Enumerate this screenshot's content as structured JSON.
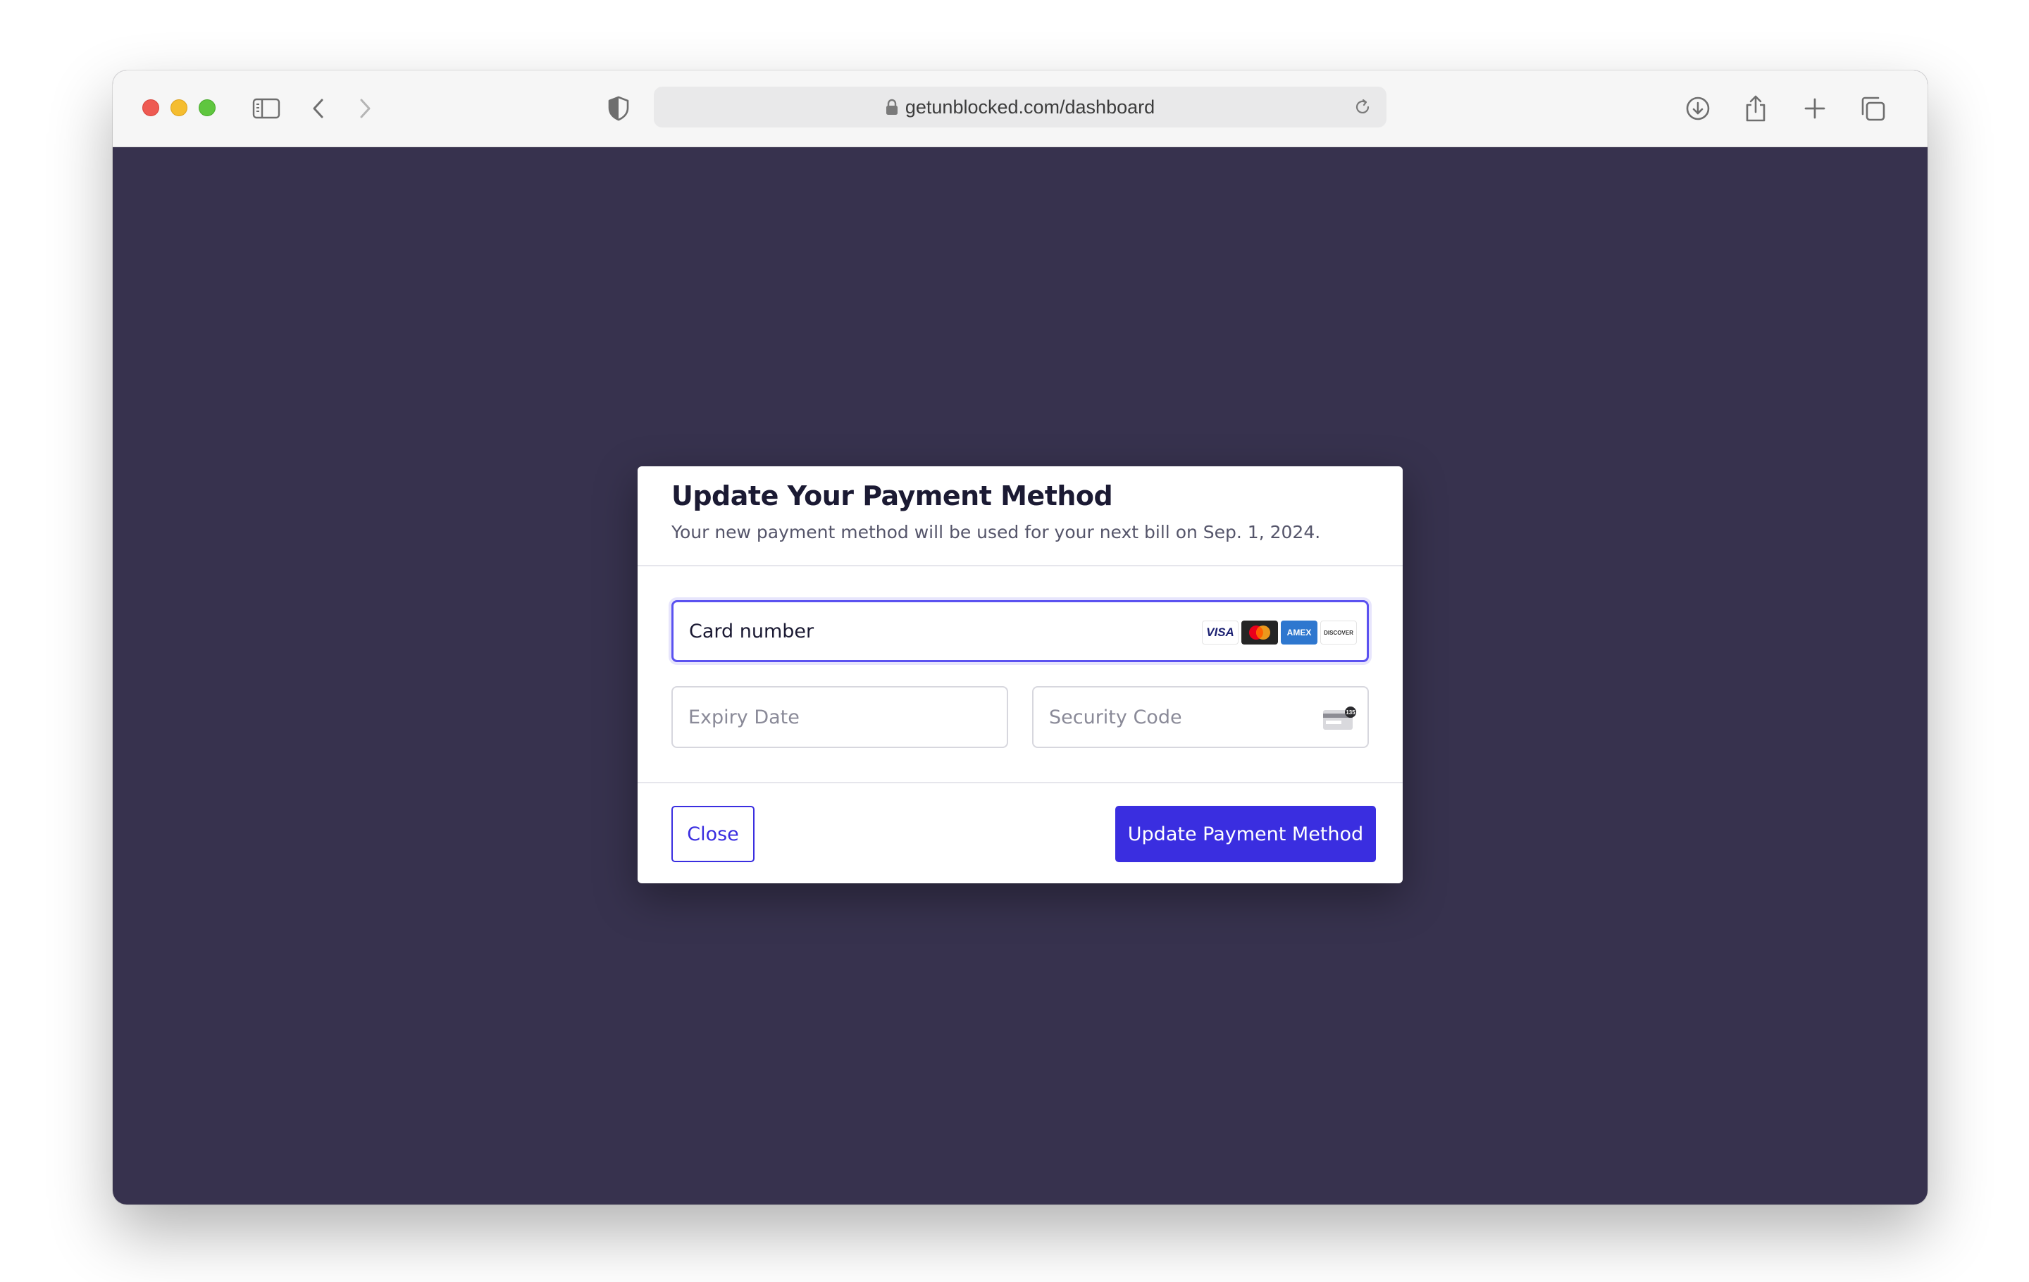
{
  "browser": {
    "url": "getunblocked.com/dashboard",
    "icons": {
      "sidebar": "sidebar-icon",
      "back": "chevron-left-icon",
      "forward": "chevron-right-icon",
      "privacy": "shield-icon",
      "lock": "lock-icon",
      "reload": "reload-icon",
      "download": "download-icon",
      "share": "share-icon",
      "new_tab": "plus-icon",
      "tabs": "tabs-overview-icon"
    }
  },
  "modal": {
    "title": "Update Your Payment Method",
    "subtitle": "Your new payment method will be used for your next bill on Sep. 1, 2024.",
    "fields": {
      "card_number_placeholder": "Card number",
      "expiry_placeholder": "Expiry Date",
      "security_code_placeholder": "Security Code"
    },
    "card_brands": {
      "visa": "VISA",
      "amex": "AMEX",
      "discover": "DISCOVER"
    },
    "cvc_hint": "135",
    "buttons": {
      "close": "Close",
      "submit": "Update Payment Method"
    }
  },
  "colors": {
    "page_background": "#37324e",
    "accent": "#3a2ee0",
    "focus_border": "#5b52f0"
  }
}
